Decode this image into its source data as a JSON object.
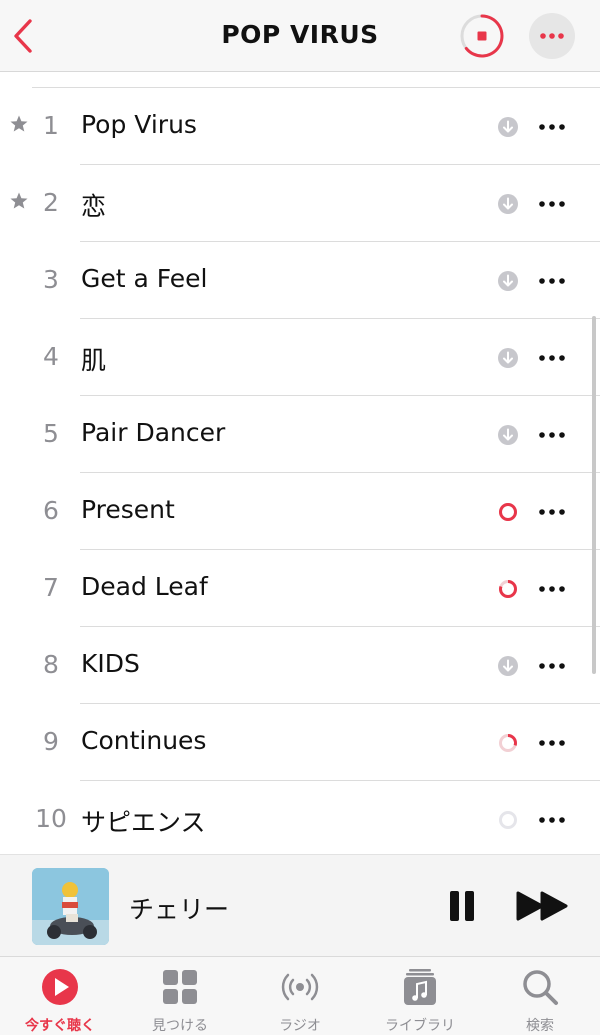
{
  "header": {
    "title": "POP VIRUS",
    "back_icon": "chevron-left-icon",
    "stop_icon": "download-stop-icon",
    "more_icon": "ellipsis-icon"
  },
  "colors": {
    "accent": "#e8364a",
    "secondary": "#8e8e93",
    "separator": "#dcdcdc"
  },
  "tracks": [
    {
      "number": "1",
      "title": "Pop Virus",
      "starred": true,
      "status": "downloadable"
    },
    {
      "number": "2",
      "title": "恋",
      "starred": true,
      "status": "downloadable"
    },
    {
      "number": "3",
      "title": "Get a Feel",
      "starred": false,
      "status": "downloadable"
    },
    {
      "number": "4",
      "title": "肌",
      "starred": false,
      "status": "downloadable"
    },
    {
      "number": "5",
      "title": "Pair Dancer",
      "starred": false,
      "status": "downloadable"
    },
    {
      "number": "6",
      "title": "Present",
      "starred": false,
      "status": "downloading",
      "progress": 1.0
    },
    {
      "number": "7",
      "title": "Dead Leaf",
      "starred": false,
      "status": "downloading",
      "progress": 0.8
    },
    {
      "number": "8",
      "title": "KIDS",
      "starred": false,
      "status": "downloadable"
    },
    {
      "number": "9",
      "title": "Continues",
      "starred": false,
      "status": "downloading",
      "progress": 0.3
    },
    {
      "number": "10",
      "title": "サピエンス",
      "starred": false,
      "status": "queued",
      "progress": 0
    }
  ],
  "now_playing": {
    "title": "チェリー",
    "pause_icon": "pause-icon",
    "next_icon": "fast-forward-icon"
  },
  "tabs": [
    {
      "label": "今すぐ聴く",
      "icon": "play-circle-icon",
      "active": true
    },
    {
      "label": "見つける",
      "icon": "grid-icon",
      "active": false
    },
    {
      "label": "ラジオ",
      "icon": "radio-waves-icon",
      "active": false
    },
    {
      "label": "ライブラリ",
      "icon": "music-library-icon",
      "active": false
    },
    {
      "label": "検索",
      "icon": "search-icon",
      "active": false
    }
  ]
}
